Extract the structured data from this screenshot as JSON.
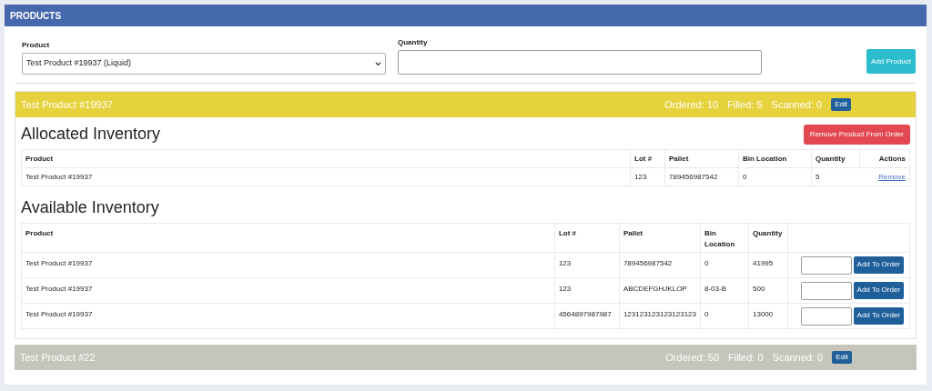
{
  "panel": {
    "title": "PRODUCTS"
  },
  "form": {
    "product_label": "Product",
    "product_value": "Test Product #19937 (Liquid)",
    "quantity_label": "Quantity",
    "add_button": "Add Product"
  },
  "products": [
    {
      "name": "Test Product #19937",
      "color": "#e6d23c",
      "ordered": "Ordered: 10",
      "filled": "Filled: 5",
      "scanned": "Scanned: 0",
      "edit": "Edit",
      "allocated": {
        "title": "Allocated Inventory",
        "remove_button": "Remove Product From Order",
        "columns": [
          "Product",
          "Lot #",
          "Pallet",
          "Bin Location",
          "Quantity",
          "Actions"
        ],
        "rows": [
          {
            "cells": [
              "Test Product #19937",
              "123",
              "789456987542",
              "0",
              "5"
            ],
            "action": "Remove"
          }
        ]
      },
      "available": {
        "title": "Available Inventory",
        "columns": [
          "Product",
          "Lot #",
          "Pallet",
          "Bin Location",
          "Quantity"
        ],
        "rows": [
          {
            "cells": [
              "Test Product #19937",
              "123",
              "789456987542",
              "0",
              "41995"
            ],
            "button": "Add To Order"
          },
          {
            "cells": [
              "Test Product #19937",
              "123",
              "ABCDEFGHJKLOP",
              "8-03-B",
              "500"
            ],
            "button": "Add To Order"
          },
          {
            "cells": [
              "Test Product #19937",
              "4564897987987",
              "123123123123123123",
              "0",
              "13000"
            ],
            "button": "Add To Order"
          }
        ]
      }
    },
    {
      "name": "Test Product #22",
      "color": "#c5c5bb",
      "ordered": "Ordered: 50",
      "filled": "Filled: 0",
      "scanned": "Scanned: 0",
      "edit": "Edit"
    }
  ]
}
